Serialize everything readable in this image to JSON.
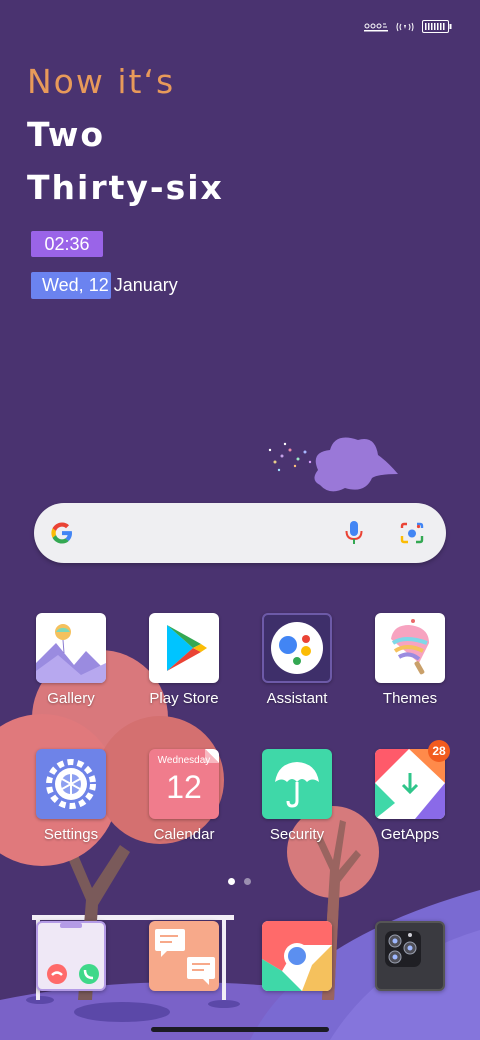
{
  "clock_widget": {
    "line1": "Now it‘s",
    "line2": "Two",
    "line3": "Thirty-six",
    "time": "02:36",
    "date": "Wed, 12 January"
  },
  "search": {
    "g_icon": "google-g-icon",
    "mic_icon": "mic-icon",
    "lens_icon": "lens-icon"
  },
  "apps": [
    {
      "label": "Gallery",
      "icon": "gallery-icon"
    },
    {
      "label": "Play Store",
      "icon": "play-store-icon"
    },
    {
      "label": "Assistant",
      "icon": "assistant-icon"
    },
    {
      "label": "Themes",
      "icon": "themes-icon"
    },
    {
      "label": "Settings",
      "icon": "settings-icon"
    },
    {
      "label": "Calendar",
      "icon": "calendar-icon",
      "weekday": "Wednesday",
      "day": "12"
    },
    {
      "label": "Security",
      "icon": "security-icon"
    },
    {
      "label": "GetApps",
      "icon": "getapps-icon",
      "badge": "28"
    }
  ],
  "page_indicator": {
    "pages": 2,
    "active": 0
  },
  "dock": [
    {
      "icon": "phone-icon"
    },
    {
      "icon": "messages-icon"
    },
    {
      "icon": "chrome-icon"
    },
    {
      "icon": "camera-icon"
    }
  ],
  "colors": {
    "background": "#4a3370",
    "accent_orange": "#e89a5a",
    "time_chip": "#9a64e8",
    "date_chip": "#6b83f0",
    "badge": "#f25b1e"
  }
}
